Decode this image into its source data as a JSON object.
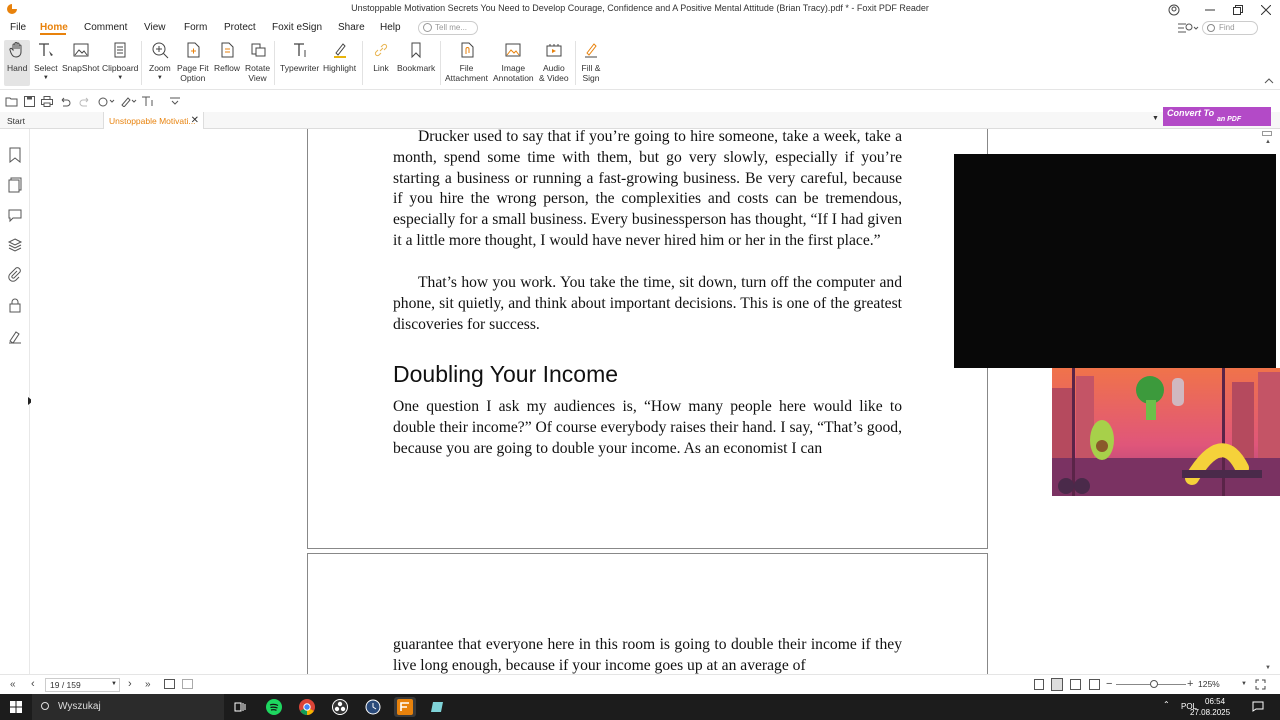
{
  "window": {
    "title": "Unstoppable Motivation Secrets You Need to Develop Courage, Confidence and A Positive Mental Attitude (Brian Tracy).pdf * - Foxit PDF Reader"
  },
  "menu": {
    "items": [
      "File",
      "Home",
      "Comment",
      "View",
      "Form",
      "Protect",
      "Foxit eSign",
      "Share",
      "Help"
    ],
    "tell_me": "Tell me..."
  },
  "search_top": {
    "placeholder": "Find"
  },
  "ribbon": {
    "hand": "Hand",
    "select": "Select",
    "snapshot": "SnapShot",
    "clipboard": "Clipboard",
    "zoom": "Zoom",
    "page_fit_1": "Page Fit",
    "page_fit_2": "Option",
    "reflow": "Reflow",
    "rotate_1": "Rotate",
    "rotate_2": "View",
    "typewriter": "Typewriter",
    "highlight": "Highlight",
    "link": "Link",
    "bookmark": "Bookmark",
    "file_att_1": "File",
    "file_att_2": "Attachment",
    "image_ann_1": "Image",
    "image_ann_2": "Annotation",
    "audio_1": "Audio",
    "audio_2": "& Video",
    "fill_1": "Fill &",
    "fill_2": "Sign"
  },
  "tabs": {
    "start": "Start",
    "doc": "Unstoppable Motivati..."
  },
  "convert_banner": {
    "line1": "Convert To",
    "line2": "an PDF"
  },
  "page1": {
    "para1": "Drucker used to say that if you’re going to hire someone, take a week, take a month, spend some time with them, but go very slowly, especially if you’re starting a business or running a fast-growing business. Be very careful, because if you hire the wrong person, the complexities and costs can be tremendous, especially for a small business. Every businessperson has thought, “If I had given it a little more thought, I would have never hired him or her in the first place.”",
    "para2": "That’s how you work. You take the time, sit down, turn off the computer and phone, sit quietly, and think about important decisions. This is one of the greatest discoveries for success.",
    "heading": "Doubling Your Income",
    "para3": "One question I ask my audiences is, “How many people here would like to double their income?” Of course everybody raises their hand. I say, “That’s good, because you are going to double your income. As an economist I can"
  },
  "page2": {
    "para1": "guarantee that everyone here in this room is going to double their income if they live long enough, because if your income goes up at an average of"
  },
  "status": {
    "page": "19 / 159",
    "zoom": "125%"
  },
  "taskbar": {
    "search": "Wyszukaj",
    "lang": "POL",
    "time": "06:54",
    "date": "27.08.2025"
  }
}
